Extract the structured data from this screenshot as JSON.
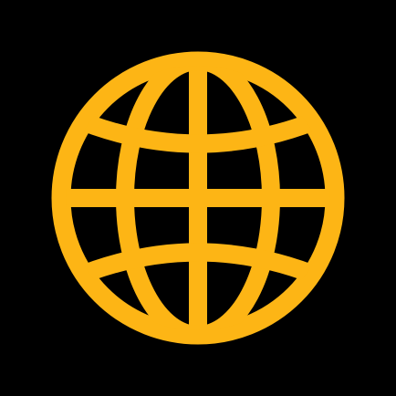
{
  "icon": {
    "name": "globe-icon",
    "color": "#FDB515",
    "background": "#000000"
  }
}
